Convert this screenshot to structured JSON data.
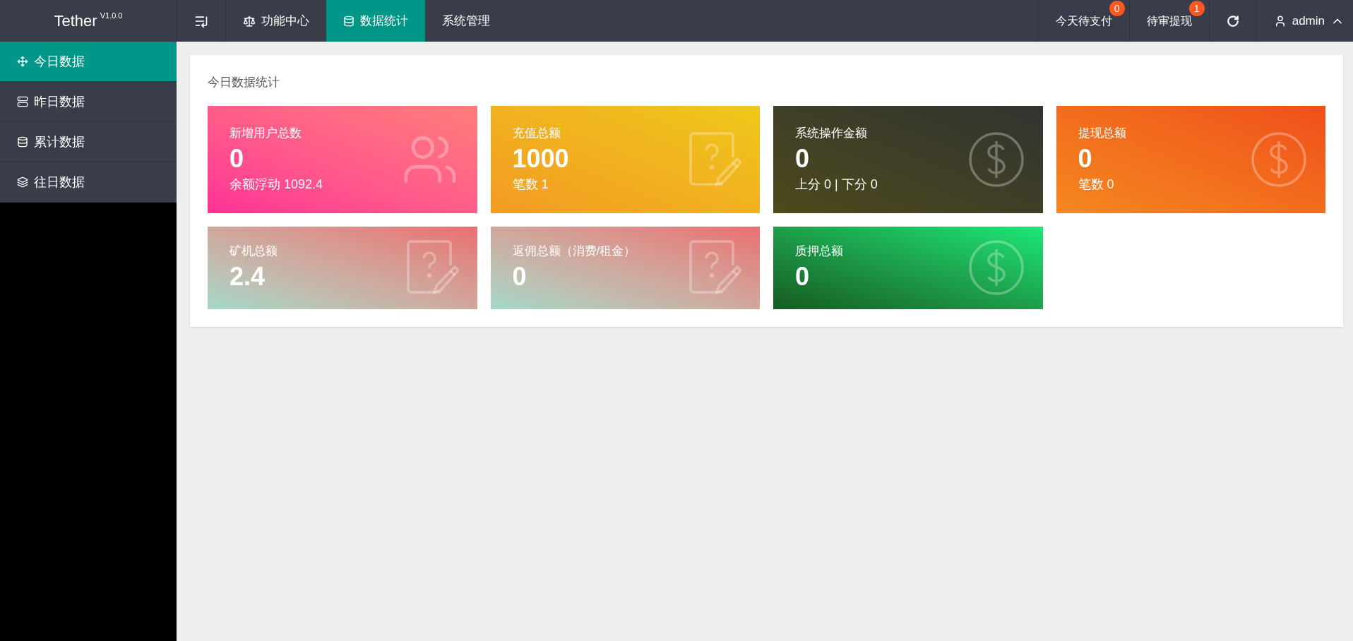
{
  "header": {
    "brand": "Tether",
    "version": "V1.0.0",
    "nav": [
      {
        "label": "功能中心",
        "selected": false
      },
      {
        "label": "数据统计",
        "selected": true
      },
      {
        "label": "系统管理",
        "selected": false
      }
    ],
    "right": [
      {
        "kind": "badge",
        "label": "今天待支付",
        "badge": "0"
      },
      {
        "kind": "badge",
        "label": "待审提现",
        "badge": "1"
      },
      {
        "kind": "refresh"
      },
      {
        "kind": "user",
        "label": "admin"
      }
    ]
  },
  "sidebar": {
    "items": [
      {
        "label": "今日数据",
        "selected": true
      },
      {
        "label": "昨日数据",
        "selected": false
      },
      {
        "label": "累计数据",
        "selected": false
      },
      {
        "label": "往日数据",
        "selected": false
      }
    ]
  },
  "panel": {
    "title": "今日数据统计",
    "cards": [
      {
        "title": "新增用户总数",
        "value": "0",
        "sub": "余额浮动 1092.4"
      },
      {
        "title": "充值总额",
        "value": "1000",
        "sub": "笔数 1"
      },
      {
        "title": "系统操作金额",
        "value": "0",
        "sub": "上分 0 | 下分 0"
      },
      {
        "title": "提现总额",
        "value": "0",
        "sub": "笔数 0"
      },
      {
        "title": "矿机总额",
        "value": "2.4"
      },
      {
        "title": "返佣总额（消费/租金）",
        "value": "0"
      },
      {
        "title": "质押总额",
        "value": "0"
      }
    ]
  }
}
